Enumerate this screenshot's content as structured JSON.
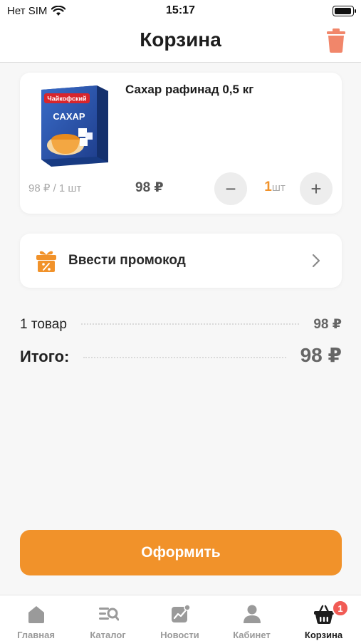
{
  "status_bar": {
    "carrier": "Нет SIM",
    "time": "15:17",
    "battery_level": 1.0
  },
  "header": {
    "title": "Корзина",
    "trash_icon": "trash-icon",
    "accent": "#f1866a"
  },
  "cart_item": {
    "name": "Сахар рафинад 0,5 кг",
    "image_brand": "Чайкофский",
    "image_label": "САХАР",
    "unit_price": "98 ₽ / 1 шт",
    "line_price": "98 ₽",
    "quantity": "1",
    "quantity_unit": "шт",
    "minus_label": "−",
    "plus_label": "+"
  },
  "promo": {
    "label": "Ввести промокод",
    "icon": "gift-percent-icon"
  },
  "summary": {
    "count_label": "1 товар",
    "count_value": "98 ₽",
    "total_label": "Итого:",
    "total_value": "98 ₽"
  },
  "checkout": {
    "label": "Оформить",
    "color": "#f1922a"
  },
  "tabbar": {
    "tabs": [
      {
        "label": "Главная",
        "icon": "home-icon"
      },
      {
        "label": "Каталог",
        "icon": "catalog-icon"
      },
      {
        "label": "Новости",
        "icon": "news-icon"
      },
      {
        "label": "Кабинет",
        "icon": "profile-icon"
      },
      {
        "label": "Корзина",
        "icon": "basket-icon",
        "badge": "1",
        "active": true
      }
    ]
  }
}
